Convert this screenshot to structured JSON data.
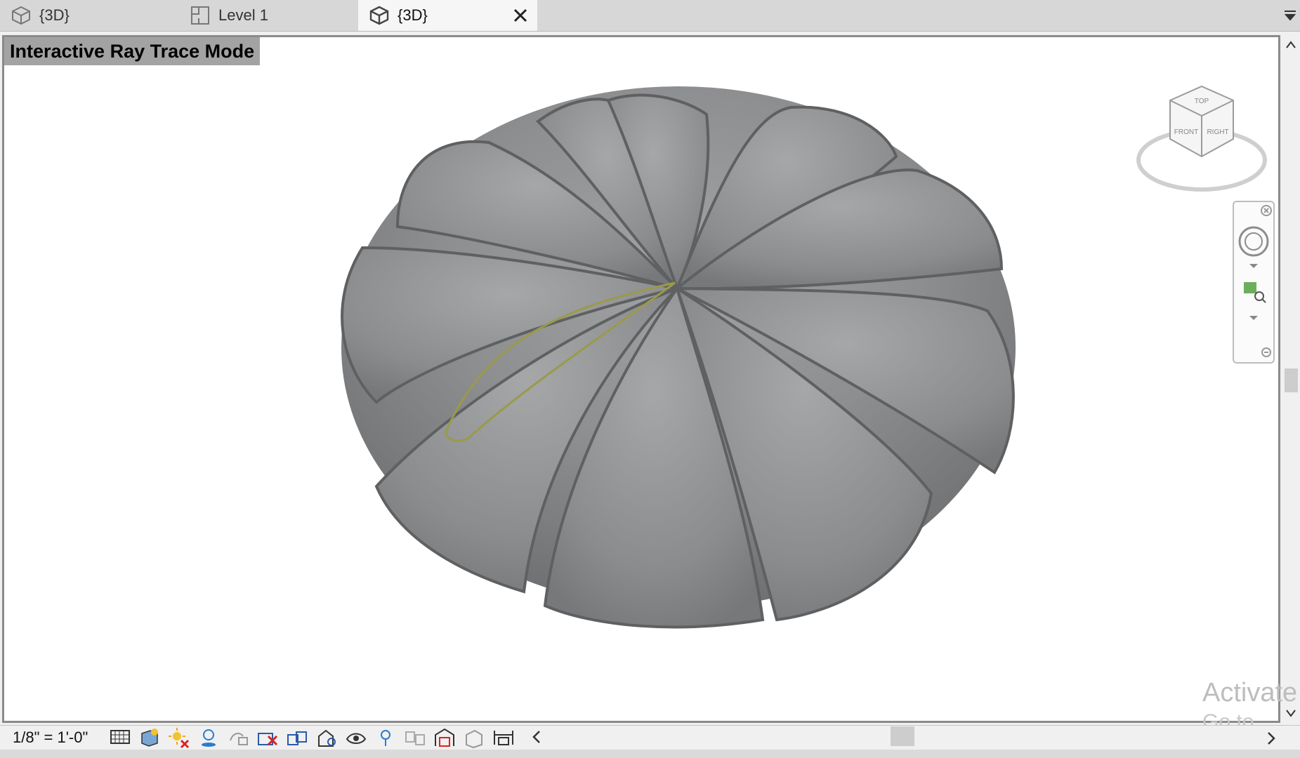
{
  "tabs": [
    {
      "label": "{3D}",
      "icon": "cube-icon"
    },
    {
      "label": "Level 1",
      "icon": "floor-plan-icon"
    },
    {
      "label": "{3D}",
      "icon": "cube-icon",
      "active": true
    }
  ],
  "viewport": {
    "mode_label": "Interactive Ray Trace Mode",
    "viewcube_faces": {
      "top": "TOP",
      "front": "FRONT",
      "right": "RIGHT"
    }
  },
  "status": {
    "scale": "1/8\" = 1'-0\""
  },
  "watermark": {
    "line1": "Activate",
    "line2": "Go to Setti"
  },
  "colors": {
    "pouf": "#8e8f90",
    "highlight": "#9a9a4a",
    "mode_label_bg": "#a3a3a3"
  }
}
